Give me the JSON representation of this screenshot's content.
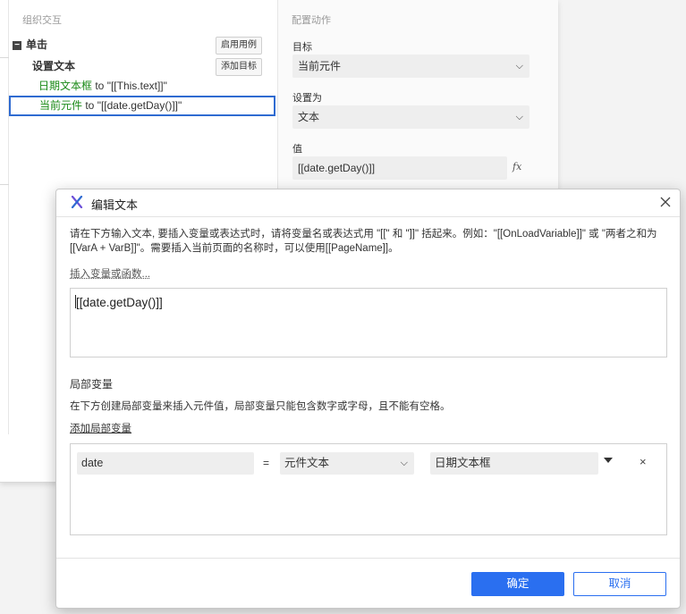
{
  "interactions": {
    "header": "组织交互",
    "event_label": "单击",
    "enable_case_button": "启用用例",
    "add_target_button": "添加目标",
    "action_label": "设置文本",
    "targets": [
      {
        "name": "日期文本框",
        "text": " to \"[[This.text]]\""
      },
      {
        "name": "当前元件",
        "text": " to \"[[date.getDay()]]\""
      }
    ]
  },
  "config": {
    "header": "配置动作",
    "target_label": "目标",
    "target_value": "当前元件",
    "set_as_label": "设置为",
    "set_as_value": "文本",
    "value_label": "值",
    "value_text": "[[date.getDay()]]",
    "fx_icon": "fx-icon"
  },
  "dialog": {
    "title": "编辑文本",
    "instruction": "请在下方输入文本, 要插入变量或表达式时，请将变量名或表达式用 \"[[\" 和 \"]]\" 括起来。例如：\"[[OnLoadVariable]]\" 或 \"两者之和为 [[VarA + VarB]]\"。需要插入当前页面的名称时，可以使用[[PageName]]。",
    "insert_link": "插入变量或函数...",
    "expression": "[[date.getDay()]]",
    "local_vars_title": "局部变量",
    "local_vars_desc": "在下方创建局部变量来插入元件值，局部变量只能包含数字或字母，且不能有空格。",
    "add_local_var": "添加局部变量",
    "local_var": {
      "name": "date",
      "equals": "=",
      "type": "元件文本",
      "widget": "日期文本框",
      "remove": "×"
    },
    "ok_label": "确定",
    "cancel_label": "取消"
  },
  "colors": {
    "primary": "#2a6ff0",
    "target_green": "#1a8a17",
    "selection_border": "#2f6bd1"
  }
}
